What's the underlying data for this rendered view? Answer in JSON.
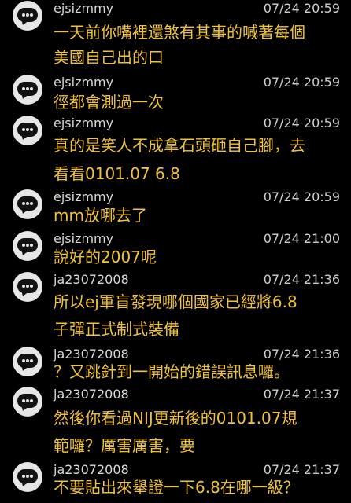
{
  "comments": [
    {
      "user": "ejsizmmy",
      "time": "07/24 20:59",
      "lines": [
        "一天前你嘴裡還煞有其事的喊著每個",
        "美國自己出的口"
      ]
    },
    {
      "user": "ejsizmmy",
      "time": "07/24 20:59",
      "lines": [
        "徑都會測過一次"
      ]
    },
    {
      "user": "ejsizmmy",
      "time": "07/24 20:59",
      "lines": [
        "真的是笑人不成拿石頭砸自己腳，去",
        "看看0101.07 6.8"
      ]
    },
    {
      "user": "ejsizmmy",
      "time": "07/24 20:59",
      "lines": [
        "mm放哪去了"
      ]
    },
    {
      "user": "ejsizmmy",
      "time": "07/24 21:00",
      "lines": [
        "說好的2007呢"
      ]
    },
    {
      "user": "ja23072008",
      "time": "07/24 21:36",
      "lines": [
        "所以ej軍盲發現哪個國家已經將6.8",
        "子彈正式制式裝備"
      ]
    },
    {
      "user": "ja23072008",
      "time": "07/24 21:36",
      "lines": [
        "？又跳針到一開始的錯誤訊息囉。"
      ]
    },
    {
      "user": "ja23072008",
      "time": "07/24 21:37",
      "lines": [
        "然後你看過NIJ更新後的0101.07規",
        "範囉？厲害厲害，要"
      ]
    },
    {
      "user": "ja23072008",
      "time": "07/24 21:37",
      "lines": [
        "不要貼出來舉證一下6.8在哪一級？"
      ]
    }
  ],
  "colors": {
    "background": "#000000",
    "message_text": "#f0c23c",
    "meta_text": "#d9d9d9",
    "avatar": "#e6e6e6"
  },
  "icons": {
    "avatar": "comment-bubble-icon"
  }
}
